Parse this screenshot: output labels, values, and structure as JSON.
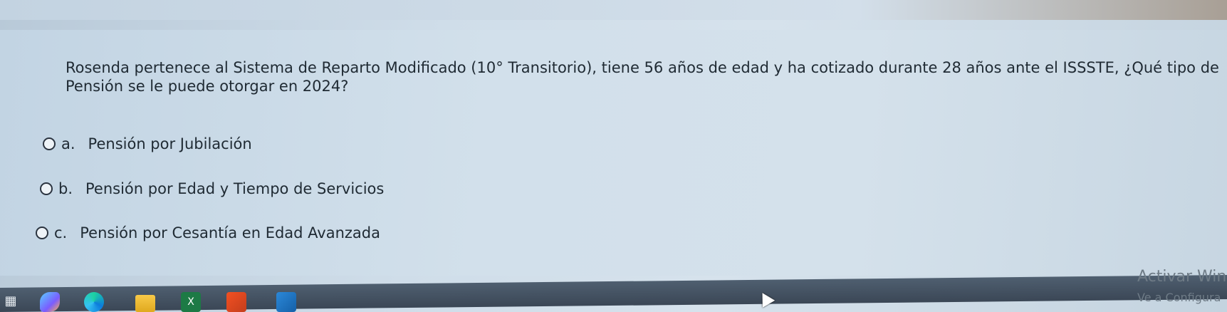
{
  "question": {
    "line1": "Rosenda pertenece al Sistema de Reparto Modificado (10° Transitorio), tiene 56 años de edad y ha cotizado durante 28 años ante el ISSSTE, ¿Qué tipo de",
    "line2": "Pensión se le puede otorgar en 2024?"
  },
  "options": [
    {
      "letter": "a.",
      "label": "Pensión por Jubilación",
      "selected": false
    },
    {
      "letter": "b.",
      "label": "Pensión por Edad y Tiempo de Servicios",
      "selected": false
    },
    {
      "letter": "c.",
      "label": "Pensión por Cesantía en Edad Avanzada",
      "selected": false
    }
  ],
  "watermark": {
    "line1": "Activar Win",
    "line2": "Ve a Configura"
  },
  "taskbar": {
    "icons": [
      "start-icon",
      "copilot-icon",
      "edge-icon",
      "file-explorer-icon",
      "excel-icon",
      "office-icon",
      "mail-icon"
    ],
    "excel_label": "X"
  }
}
